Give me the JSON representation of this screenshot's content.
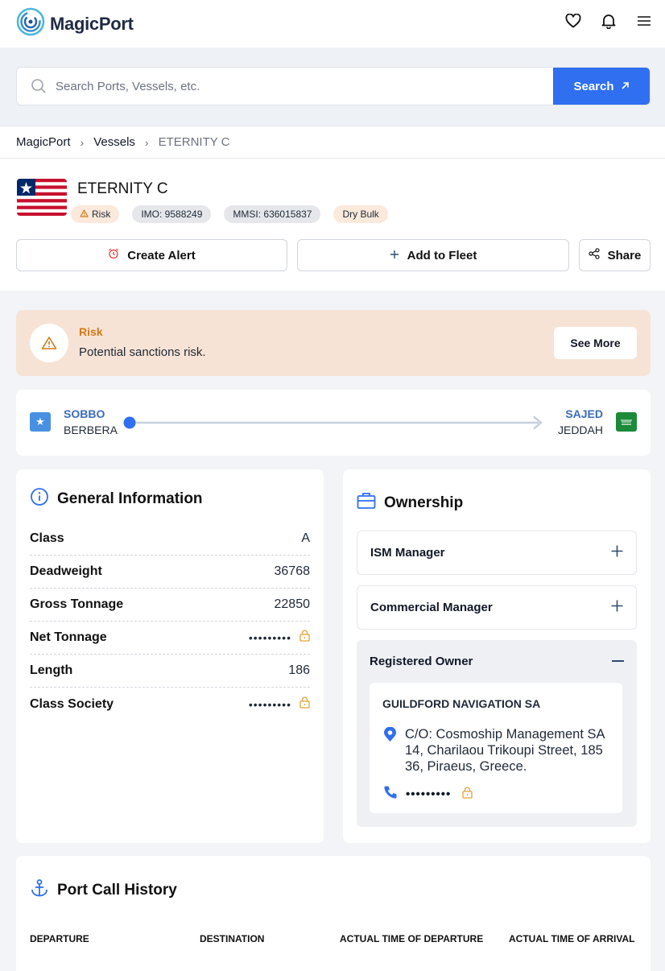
{
  "header": {
    "brand": "MagicPort",
    "icons": [
      "heart-icon",
      "bell-icon",
      "menu-icon"
    ]
  },
  "search": {
    "placeholder": "Search Ports, Vessels, etc.",
    "button_label": "Search"
  },
  "breadcrumb": [
    "MagicPort",
    "Vessels",
    "ETERNITY C"
  ],
  "vessel": {
    "name": "ETERNITY C",
    "flag": "Liberia",
    "badges": {
      "risk": "Risk",
      "imo": "IMO: 9588249",
      "mmsi": "MMSI: 636015837",
      "type": "Dry Bulk"
    },
    "actions": {
      "create_alert": "Create Alert",
      "add_to_fleet": "Add to Fleet",
      "share": "Share"
    }
  },
  "risk_banner": {
    "title": "Risk",
    "text": "Potential sanctions risk.",
    "button": "See More"
  },
  "route": {
    "from": {
      "code": "SOBBO",
      "name": "BERBERA"
    },
    "to": {
      "code": "SAJED",
      "name": "JEDDAH"
    }
  },
  "general_info": {
    "title": "General Information",
    "rows": [
      {
        "label": "Class",
        "value": "A",
        "locked": false
      },
      {
        "label": "Deadweight",
        "value": "36768",
        "locked": false
      },
      {
        "label": "Gross Tonnage",
        "value": "22850",
        "locked": false
      },
      {
        "label": "Net Tonnage",
        "value": "•••••••••",
        "locked": true
      },
      {
        "label": "Length",
        "value": "186",
        "locked": false
      },
      {
        "label": "Class Society",
        "value": "•••••••••",
        "locked": true
      }
    ]
  },
  "ownership": {
    "title": "Ownership",
    "ism_manager": "ISM Manager",
    "commercial_manager": "Commercial Manager",
    "registered_owner": {
      "label": "Registered Owner",
      "company": "GUILDFORD NAVIGATION SA",
      "address": "C/O: Cosmoship Management SA 14, Charilaou Trikoupi Street, 185 36, Piraeus, Greece.",
      "phone": "•••••••••"
    }
  },
  "port_call_history": {
    "title": "Port Call History",
    "columns": [
      "DEPARTURE",
      "DESTINATION",
      "ACTUAL TIME OF DEPARTURE",
      "ACTUAL TIME OF ARRIVAL"
    ]
  },
  "colors": {
    "primary": "#2f6ff0",
    "risk": "#d17a1a",
    "risk_bg": "#f7e3d6",
    "route": "#3a6db8"
  }
}
